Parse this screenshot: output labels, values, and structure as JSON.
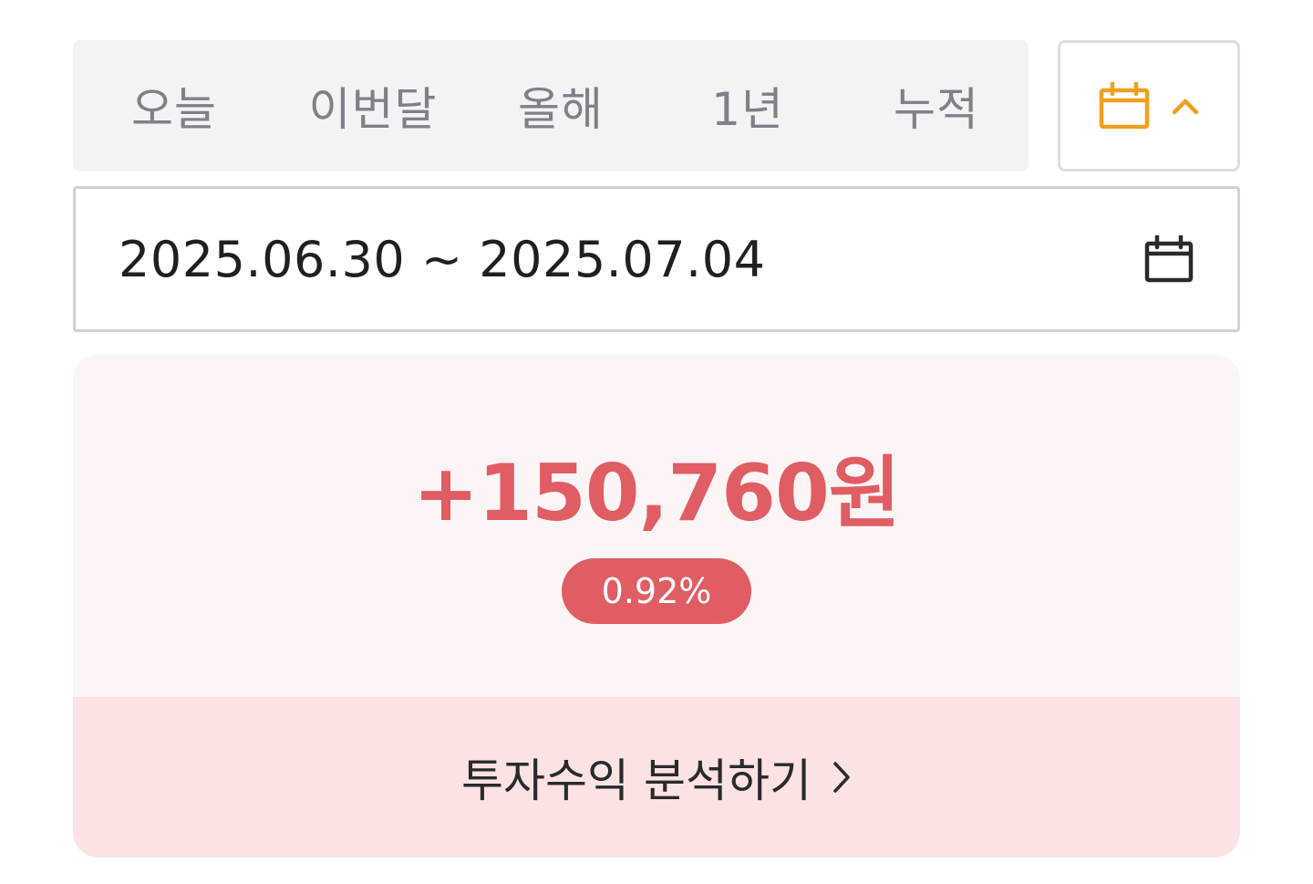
{
  "period_tabs": [
    {
      "label": "오늘"
    },
    {
      "label": "이번달"
    },
    {
      "label": "올해"
    },
    {
      "label": "1년"
    },
    {
      "label": "누적"
    }
  ],
  "calendar_toggle": {
    "icon": "calendar-icon",
    "chevron": "chevron-up-icon",
    "accent_color": "#f0a020"
  },
  "date_range": {
    "value": "2025.06.30 ~ 2025.07.04",
    "icon": "calendar-icon"
  },
  "profit": {
    "amount": "+150,760원",
    "rate": "0.92%",
    "color": "#e05d64"
  },
  "analysis": {
    "label": "투자수익 분석하기",
    "icon": "chevron-right-icon"
  }
}
